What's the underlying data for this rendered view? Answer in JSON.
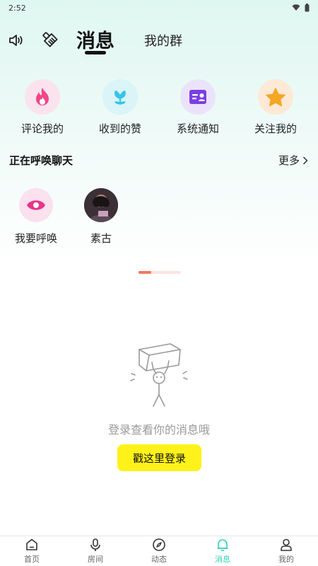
{
  "status_bar": {
    "time": "2:52"
  },
  "header": {
    "tabs": [
      {
        "label": "消息",
        "active": true
      },
      {
        "label": "我的群",
        "active": false
      }
    ]
  },
  "quick_actions": [
    {
      "label": "评论我的",
      "icon": "fire-icon",
      "color": "#f0458a"
    },
    {
      "label": "收到的赞",
      "icon": "flower-icon",
      "color": "#34c5e6"
    },
    {
      "label": "系统通知",
      "icon": "id-card-icon",
      "color": "#7b3fe4"
    },
    {
      "label": "关注我的",
      "icon": "star-icon",
      "color": "#f5a623"
    }
  ],
  "calling_section": {
    "title": "正在呼唤聊天",
    "more_label": "更多",
    "items": [
      {
        "label": "我要呼唤",
        "icon": "eye-icon"
      },
      {
        "label": "素古",
        "icon": "avatar"
      }
    ]
  },
  "empty_state": {
    "text": "登录查看你的消息哦",
    "button_label": "戳这里登录"
  },
  "bottom_nav": [
    {
      "label": "首页",
      "icon": "home-icon",
      "active": false
    },
    {
      "label": "房间",
      "icon": "microphone-icon",
      "active": false
    },
    {
      "label": "动态",
      "icon": "compass-icon",
      "active": false
    },
    {
      "label": "消息",
      "icon": "bell-icon",
      "active": true
    },
    {
      "label": "我的",
      "icon": "person-icon",
      "active": false
    }
  ],
  "colors": {
    "accent": "#2fd0b3",
    "login_button": "#fff21a",
    "indicator": "#f07a5a"
  }
}
